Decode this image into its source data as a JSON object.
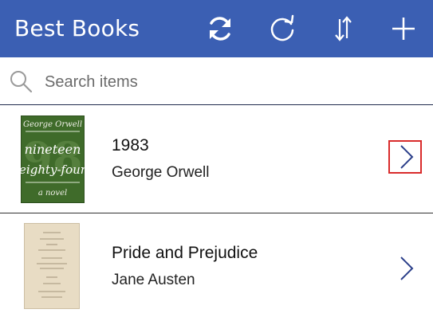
{
  "header": {
    "title": "Best Books",
    "bg_color": "#3b5fb3",
    "icons": [
      "refresh-icon",
      "reload-icon",
      "sort-icon",
      "add-icon"
    ]
  },
  "search": {
    "placeholder": "Search items",
    "value": ""
  },
  "items": [
    {
      "title": "1983",
      "author": "George Orwell",
      "cover_icon": "book-cover-1984",
      "cover_text": [
        "George Orwell",
        "nineteen",
        "eighty-four",
        "a novel",
        "1984"
      ]
    },
    {
      "title": "Pride and Prejudice",
      "author": "Jane Austen",
      "cover_icon": "book-cover-pride-and-prejudice"
    }
  ],
  "selection_color": "#d92b2b"
}
